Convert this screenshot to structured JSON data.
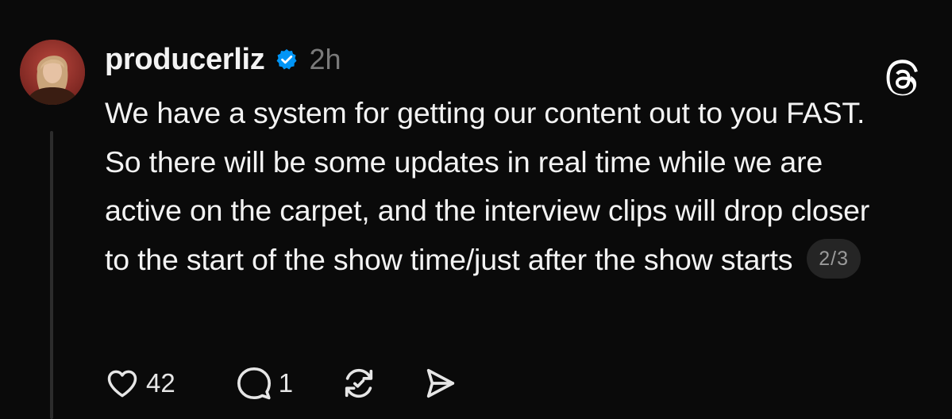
{
  "post": {
    "author": {
      "username": "producerliz",
      "verified": true,
      "avatar_icon": "profile-photo"
    },
    "timestamp": "2h",
    "text": "We have a system for getting our content out to you FAST. So there will be some updates in real time while we are active on the carpet, and the interview clips will drop closer to the start of the show time/just after the show starts",
    "page_indicator": "2/3",
    "actions": {
      "like": {
        "icon": "heart-icon",
        "count": "42"
      },
      "reply": {
        "icon": "comment-icon",
        "count": "1"
      },
      "repost": {
        "icon": "repost-icon"
      },
      "share": {
        "icon": "send-icon"
      }
    },
    "app_logo": "threads-logo-icon"
  },
  "colors": {
    "background": "#0a0a0a",
    "text": "#f3f3f3",
    "muted": "#7a7a7a",
    "verified_blue": "#0095f6",
    "badge_bg": "#252525"
  }
}
